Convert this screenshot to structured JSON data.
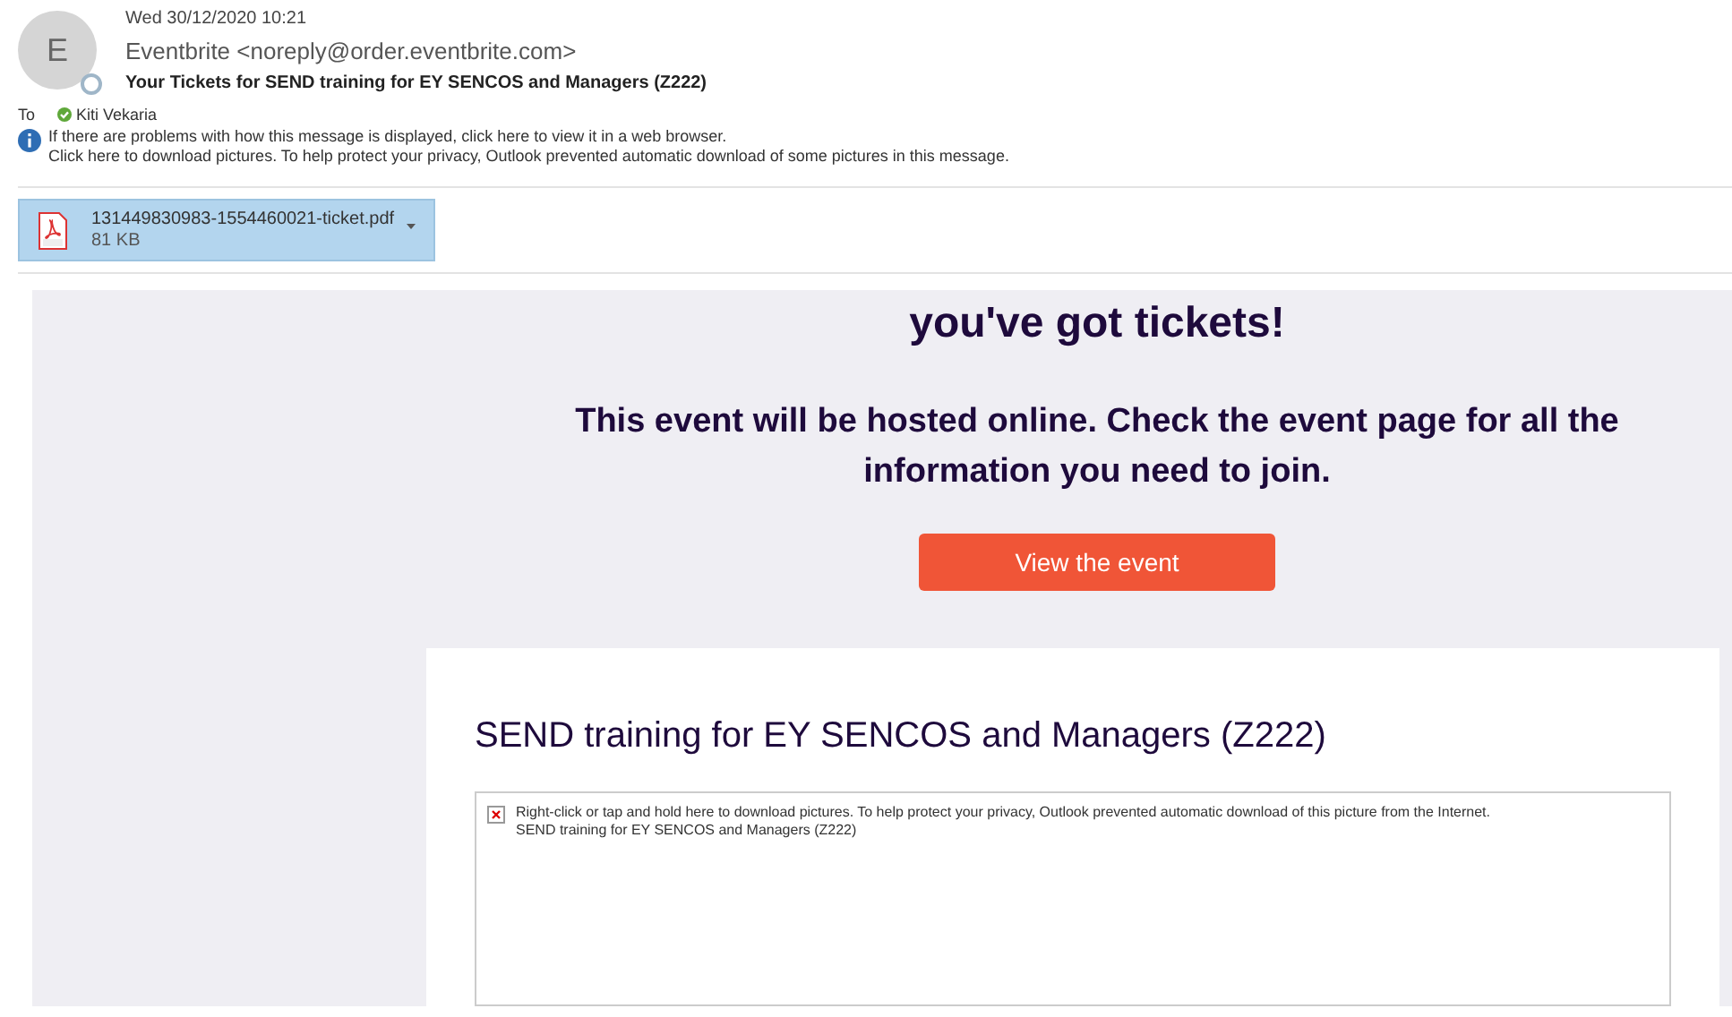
{
  "header": {
    "avatar_letter": "E",
    "date": "Wed 30/12/2020 10:21",
    "sender": "Eventbrite <noreply@order.eventbrite.com>",
    "subject": "Your Tickets for SEND training for EY SENCOS and Managers (Z222)",
    "to_label": "To",
    "recipient": "Kiti Vekaria",
    "info_lines": [
      "If there are problems with how this message is displayed, click here to view it in a web browser.",
      "Click here to download pictures. To help protect your privacy, Outlook prevented automatic download of some pictures in this message."
    ]
  },
  "attachment": {
    "filename": "131449830983-1554460021-ticket.pdf",
    "size": "81 KB",
    "selected": true
  },
  "body": {
    "heading": "you've got tickets!",
    "message": "This event will be hosted online. Check the event page for all the information you need to join.",
    "button": "View the event",
    "card_title": "SEND training for EY SENCOS and Managers (Z222)",
    "blocked_image_text": [
      "Right-click or tap and hold here to download pictures. To help protect your privacy, Outlook prevented automatic download of this picture from the Internet.",
      "SEND training for EY SENCOS and Managers (Z222)"
    ]
  }
}
